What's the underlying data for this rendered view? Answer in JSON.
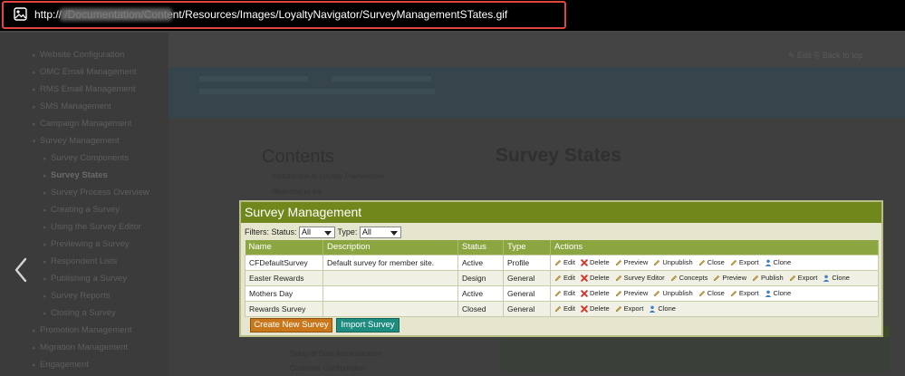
{
  "url_bar": {
    "text_visible": "http:// /Documentation/Content/Resources/Images/LoyaltyNavigator/SurveyManagementSTates.gif"
  },
  "doc": {
    "sidebar_items": [
      {
        "label": "Website Configuration",
        "arrow": "▸",
        "indent": false,
        "bold": false
      },
      {
        "label": "OMC Email Management",
        "arrow": "▸",
        "indent": false,
        "bold": false
      },
      {
        "label": "RMS Email Management",
        "arrow": "▸",
        "indent": false,
        "bold": false
      },
      {
        "label": "SMS Management",
        "arrow": "▸",
        "indent": false,
        "bold": false
      },
      {
        "label": "Campaign Management",
        "arrow": "▸",
        "indent": false,
        "bold": false
      },
      {
        "label": "Survey Management",
        "arrow": "▾",
        "indent": false,
        "bold": false
      },
      {
        "label": "Survey Components",
        "arrow": "▸",
        "indent": true,
        "bold": false
      },
      {
        "label": "Survey States",
        "arrow": "▸",
        "indent": true,
        "bold": true
      },
      {
        "label": "Survey Process Overview",
        "arrow": "▸",
        "indent": true,
        "bold": false
      },
      {
        "label": "Creating a Survey",
        "arrow": "▸",
        "indent": true,
        "bold": false
      },
      {
        "label": "Using the Survey Editor",
        "arrow": "▸",
        "indent": true,
        "bold": false
      },
      {
        "label": "Previewing a Survey",
        "arrow": "▸",
        "indent": true,
        "bold": false
      },
      {
        "label": "Respondent Lists",
        "arrow": "▸",
        "indent": true,
        "bold": false
      },
      {
        "label": "Publishing a Survey",
        "arrow": "▸",
        "indent": true,
        "bold": false
      },
      {
        "label": "Survey Reports",
        "arrow": "▸",
        "indent": true,
        "bold": false
      },
      {
        "label": "Closing a Survey",
        "arrow": "▸",
        "indent": true,
        "bold": false
      },
      {
        "label": "Promotion Management",
        "arrow": "▸",
        "indent": false,
        "bold": false
      },
      {
        "label": "Migration Management",
        "arrow": "▸",
        "indent": false,
        "bold": false
      },
      {
        "label": "Engagement",
        "arrow": "▸",
        "indent": false,
        "bold": false
      }
    ],
    "tools": "✎ Edit   ⎘ Back to top",
    "contents_title": "Contents",
    "heading": "Survey States",
    "toc": [
      "Introduction to Loyalty Frameworks",
      "Welcome to the",
      "Setup of Data Administration",
      "Customer Configuration"
    ]
  },
  "survey_panel": {
    "title": "Survey Management",
    "filters_label": "Filters: Status:",
    "status_value": "All",
    "type_label": "Type:",
    "type_value": "All",
    "columns": {
      "name": "Name",
      "description": "Description",
      "status": "Status",
      "type": "Type",
      "actions": "Actions"
    },
    "rows": [
      {
        "name": "CFDefaultSurvey",
        "description": "Default survey for member site.",
        "status": "Active",
        "type": "Profile",
        "actions": [
          {
            "label": "Edit",
            "icon": "pencil-icon"
          },
          {
            "label": "Delete",
            "icon": "delete-x-icon"
          },
          {
            "label": "Preview",
            "icon": "pencil-icon"
          },
          {
            "label": "Unpublish",
            "icon": "pencil-icon"
          },
          {
            "label": "Close",
            "icon": "pencil-icon"
          },
          {
            "label": "Export",
            "icon": "pencil-icon"
          },
          {
            "label": "Clone",
            "icon": "person-icon"
          }
        ]
      },
      {
        "name": "Easter Rewards",
        "description": "",
        "status": "Design",
        "type": "General",
        "actions": [
          {
            "label": "Edit",
            "icon": "pencil-icon"
          },
          {
            "label": "Delete",
            "icon": "delete-x-icon"
          },
          {
            "label": "Survey Editor",
            "icon": "pencil-icon"
          },
          {
            "label": "Concepts",
            "icon": "pencil-icon"
          },
          {
            "label": "Preview",
            "icon": "pencil-icon"
          },
          {
            "label": "Publish",
            "icon": "pencil-icon"
          },
          {
            "label": "Export",
            "icon": "pencil-icon"
          },
          {
            "label": "Clone",
            "icon": "person-icon"
          }
        ]
      },
      {
        "name": "Mothers Day",
        "description": "",
        "status": "Active",
        "type": "General",
        "actions": [
          {
            "label": "Edit",
            "icon": "pencil-icon"
          },
          {
            "label": "Delete",
            "icon": "delete-x-icon"
          },
          {
            "label": "Preview",
            "icon": "pencil-icon"
          },
          {
            "label": "Unpublish",
            "icon": "pencil-icon"
          },
          {
            "label": "Close",
            "icon": "pencil-icon"
          },
          {
            "label": "Export",
            "icon": "pencil-icon"
          },
          {
            "label": "Clone",
            "icon": "person-icon"
          }
        ]
      },
      {
        "name": "Rewards Survey",
        "description": "",
        "status": "Closed",
        "type": "General",
        "actions": [
          {
            "label": "Edit",
            "icon": "pencil-icon"
          },
          {
            "label": "Delete",
            "icon": "delete-x-icon"
          },
          {
            "label": "Export",
            "icon": "pencil-icon"
          },
          {
            "label": "Clone",
            "icon": "person-icon"
          }
        ]
      }
    ],
    "create_button": "Create New Survey",
    "import_button": "Import Survey"
  },
  "colors": {
    "title_bar": "#6f871b",
    "header_row": "#8ba640",
    "create_button": "#c8771b",
    "import_button": "#1f8c80",
    "url_highlight": "#e0453f",
    "delete_icon": "#d8342c",
    "pencil_icon": "#c9a341",
    "person_icon": "#3f7fc4"
  }
}
